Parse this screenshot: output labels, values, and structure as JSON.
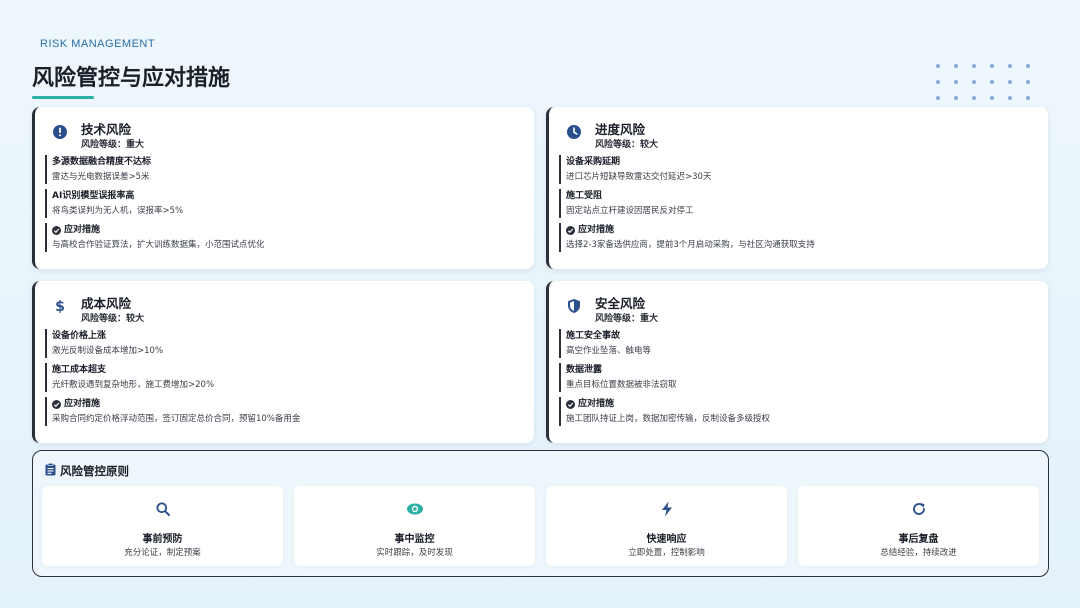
{
  "header": {
    "eyebrow": "RISK MANAGEMENT",
    "title": "风险管控与应对措施"
  },
  "risks": [
    {
      "name": "技术风险",
      "level": "风险等级：重大",
      "icon": "alert-circle-icon",
      "items": [
        {
          "title": "多源数据融合精度不达标",
          "desc": "雷达与光电数据误差>5米"
        },
        {
          "title": "AI识别模型误报率高",
          "desc": "将鸟类误判为无人机，误报率>5%"
        }
      ],
      "measure": {
        "title": "应对措施",
        "desc": "与高校合作验证算法，扩大训练数据集，小范围试点优化"
      }
    },
    {
      "name": "进度风险",
      "level": "风险等级：较大",
      "icon": "clock-icon",
      "items": [
        {
          "title": "设备采购延期",
          "desc": "进口芯片短缺导致雷达交付延迟>30天"
        },
        {
          "title": "施工受阻",
          "desc": "固定站点立杆建设因居民反对停工"
        }
      ],
      "measure": {
        "title": "应对措施",
        "desc": "选择2-3家备选供应商，提前3个月启动采购，与社区沟通获取支持"
      }
    },
    {
      "name": "成本风险",
      "level": "风险等级：较大",
      "icon": "dollar-icon",
      "items": [
        {
          "title": "设备价格上涨",
          "desc": "激光反制设备成本增加>10%"
        },
        {
          "title": "施工成本超支",
          "desc": "光纤敷设遇到复杂地形，施工费增加>20%"
        }
      ],
      "measure": {
        "title": "应对措施",
        "desc": "采购合同约定价格浮动范围，签订固定总价合同，预留10%备用金"
      }
    },
    {
      "name": "安全风险",
      "level": "风险等级：重大",
      "icon": "shield-icon",
      "items": [
        {
          "title": "施工安全事故",
          "desc": "高空作业坠落、触电等"
        },
        {
          "title": "数据泄露",
          "desc": "重点目标位置数据被非法窃取"
        }
      ],
      "measure": {
        "title": "应对措施",
        "desc": "施工团队持证上岗，数据加密传输，反制设备多级授权"
      }
    }
  ],
  "principles": {
    "title": "风险管控原则",
    "items": [
      {
        "name": "事前预防",
        "desc": "充分论证，制定预案",
        "icon": "search-icon"
      },
      {
        "name": "事中监控",
        "desc": "实时跟踪，及时发现",
        "icon": "eye-icon"
      },
      {
        "name": "快速响应",
        "desc": "立即处置，控制影响",
        "icon": "bolt-icon"
      },
      {
        "name": "事后复盘",
        "desc": "总结经验，持续改进",
        "icon": "refresh-icon"
      }
    ]
  },
  "colors": {
    "accent": "#2bb0a4",
    "navy": "#2a4f8a",
    "card_border": "#2a2f3a"
  }
}
